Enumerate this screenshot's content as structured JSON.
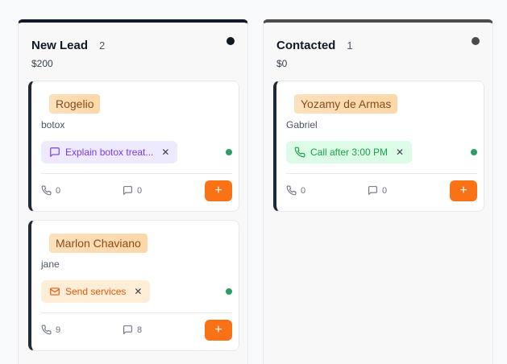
{
  "columns": [
    {
      "title": "New Lead",
      "count": "2",
      "amount": "$200",
      "dot_color": "#111827",
      "cards": [
        {
          "name": "Rogelio",
          "subtitle": "botox",
          "task": {
            "label": "Explain botox treat...",
            "icon": "message-square-icon",
            "color": "purple"
          },
          "status_color": "#2e9d65",
          "calls": "0",
          "comments": "0",
          "add_label": "+"
        },
        {
          "name": "Marlon Chaviano",
          "subtitle": "jane",
          "task": {
            "label": "Send services",
            "icon": "mail-icon",
            "color": "orange"
          },
          "status_color": "#2e9d65",
          "calls": "9",
          "comments": "8",
          "add_label": "+"
        }
      ]
    },
    {
      "title": "Contacted",
      "count": "1",
      "amount": "$0",
      "dot_color": "#4b4b4b",
      "cards": [
        {
          "name": "Yozamy de Armas",
          "subtitle": "Gabriel",
          "task": {
            "label": "Call after 3:00 PM",
            "icon": "phone-icon",
            "color": "green"
          },
          "status_color": "#2e9d65",
          "calls": "0",
          "comments": "0",
          "add_label": "+"
        }
      ]
    }
  ]
}
